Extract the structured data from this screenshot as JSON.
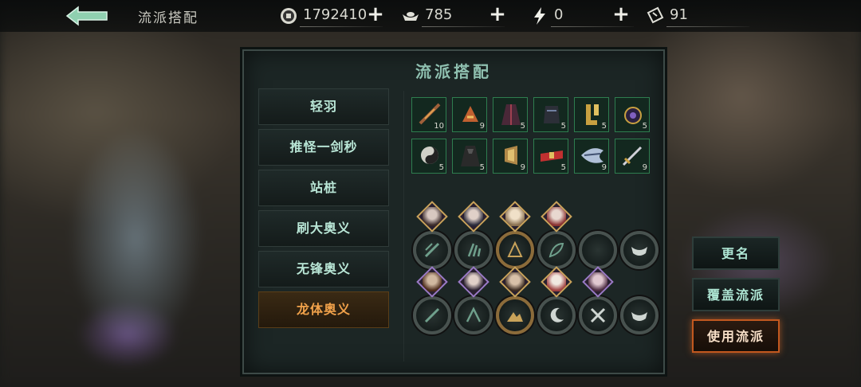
{
  "header": {
    "title": "流派搭配",
    "resources": [
      {
        "name": "coin",
        "value": "1792410",
        "icon": "coin-icon"
      },
      {
        "name": "ingot",
        "value": "785",
        "icon": "ingot-icon"
      },
      {
        "name": "stamina",
        "value": "0",
        "icon": "lightning-icon"
      },
      {
        "name": "ticket",
        "value": "91",
        "icon": "ticket-icon"
      }
    ],
    "plus_label": "+"
  },
  "panel": {
    "title": "流派搭配",
    "schools": [
      {
        "label": "轻羽",
        "active": false
      },
      {
        "label": "推怪一剑秒",
        "active": false
      },
      {
        "label": "站桩",
        "active": false
      },
      {
        "label": "刷大奥义",
        "active": false
      },
      {
        "label": "无锋奥义",
        "active": false
      },
      {
        "label": "龙体奥义",
        "active": true
      }
    ],
    "equipment": [
      {
        "level": "10"
      },
      {
        "level": "9"
      },
      {
        "level": "5"
      },
      {
        "level": "5"
      },
      {
        "level": "5"
      },
      {
        "level": "5"
      },
      {
        "level": "5"
      },
      {
        "level": "5"
      },
      {
        "level": "9"
      },
      {
        "level": "5"
      },
      {
        "level": "9"
      },
      {
        "level": "9"
      }
    ]
  },
  "actions": {
    "rename": "更名",
    "overwrite": "覆盖流派",
    "use": "使用流派"
  },
  "colors": {
    "accent_teal": "#aee6d4",
    "active_orange": "#f0a14a",
    "use_border": "#c2581f"
  }
}
